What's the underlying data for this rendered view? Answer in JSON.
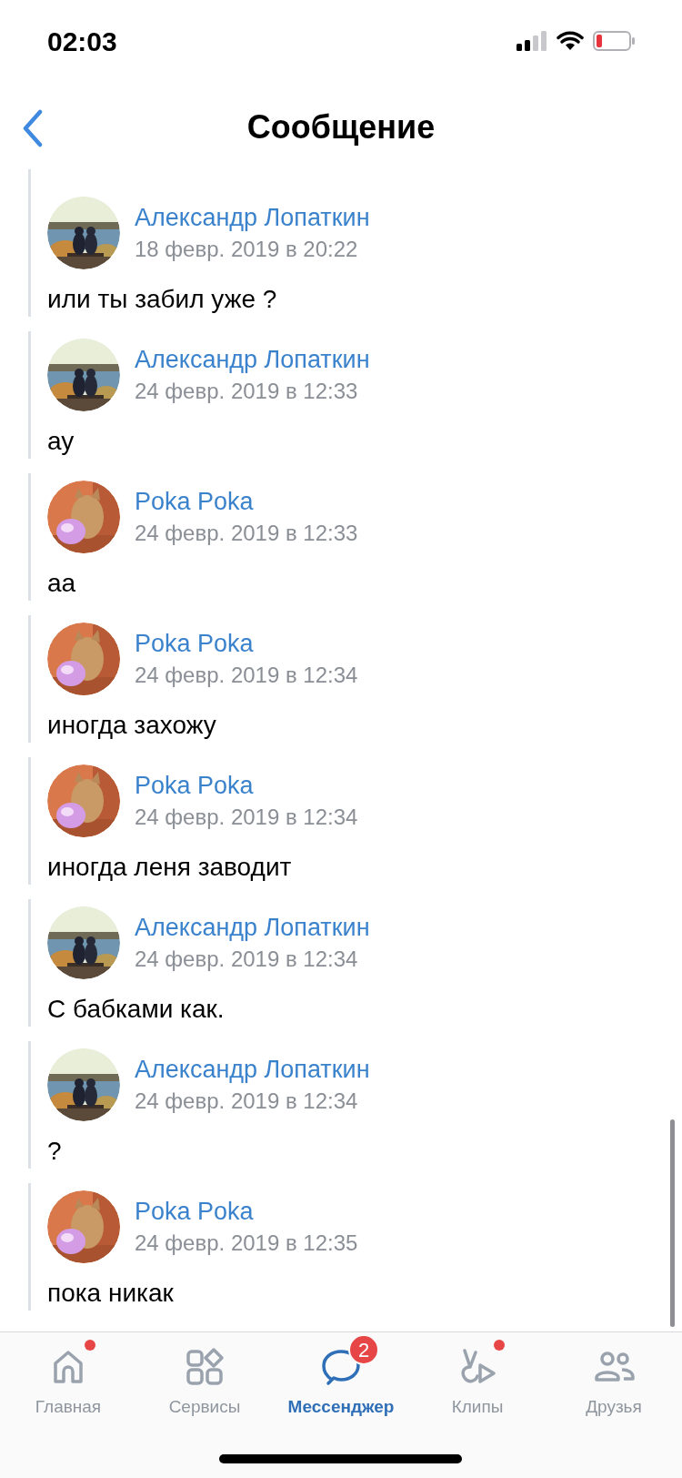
{
  "status_bar": {
    "time": "02:03"
  },
  "header": {
    "title": "Сообщение"
  },
  "messages": [
    {
      "author": "Александр Лопаткин",
      "date": "18 февр. 2019 в 20:22",
      "text": "или ты забил уже ?"
    },
    {
      "author": "Александр Лопаткин",
      "date": "24 февр. 2019 в 12:33",
      "text": "ау"
    },
    {
      "author": "Poka Poka",
      "date": "24 февр. 2019 в 12:33",
      "text": "аа"
    },
    {
      "author": "Poka Poka",
      "date": "24 февр. 2019 в 12:34",
      "text": "иногда захожу"
    },
    {
      "author": "Poka Poka",
      "date": "24 февр. 2019 в 12:34",
      "text": "иногда леня заводит"
    },
    {
      "author": "Александр Лопаткин",
      "date": "24 февр. 2019 в 12:34",
      "text": "С бабками как."
    },
    {
      "author": "Александр Лопаткин",
      "date": "24 февр. 2019 в 12:34",
      "text": "?"
    },
    {
      "author": "Poka Poka",
      "date": "24 февр. 2019 в 12:35",
      "text": "пока никак"
    }
  ],
  "tab_bar": [
    {
      "label": "Главная",
      "selected": false,
      "dot": true
    },
    {
      "label": "Сервисы",
      "selected": false,
      "dot": false
    },
    {
      "label": "Мессенджер",
      "selected": true,
      "dot": false,
      "badge": "2"
    },
    {
      "label": "Клипы",
      "selected": false,
      "dot": true
    },
    {
      "label": "Друзья",
      "selected": false,
      "dot": false
    }
  ]
}
